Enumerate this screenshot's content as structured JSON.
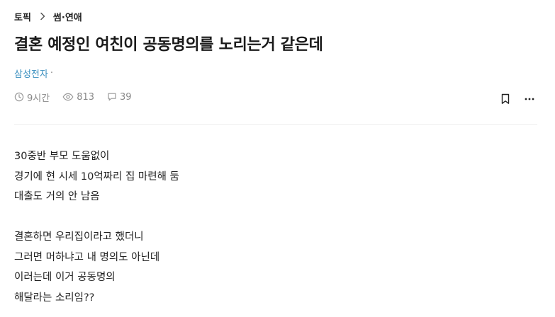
{
  "breadcrumb": {
    "root": "토픽",
    "current": "썸·연애"
  },
  "post": {
    "title": "결혼 예정인 여친이 공동명의를 노리는거 같은데",
    "author": "삼성전자",
    "author_sep": "·",
    "time": "9시간",
    "views": "813",
    "comments": "39",
    "body_lines": [
      "30중반 부모 도움없이",
      "경기에 현 시세 10억짜리 집 마련해 둠",
      "대출도 거의 안 남음",
      "",
      "결혼하면 우리집이라고 했더니",
      "그러면 머하냐고 내 명의도 아닌데",
      "이러는데 이거 공동명의",
      "해달라는 소리임??"
    ]
  },
  "icons": {
    "breadcrumb_sep": "chevron-right-icon",
    "time": "clock-icon",
    "views": "eye-icon",
    "comments": "speech-bubble-icon",
    "bookmark": "bookmark-icon",
    "more": "more-horizontal-icon"
  },
  "colors": {
    "author": "#3a8fbf",
    "meta": "#888888",
    "text": "#222222"
  }
}
